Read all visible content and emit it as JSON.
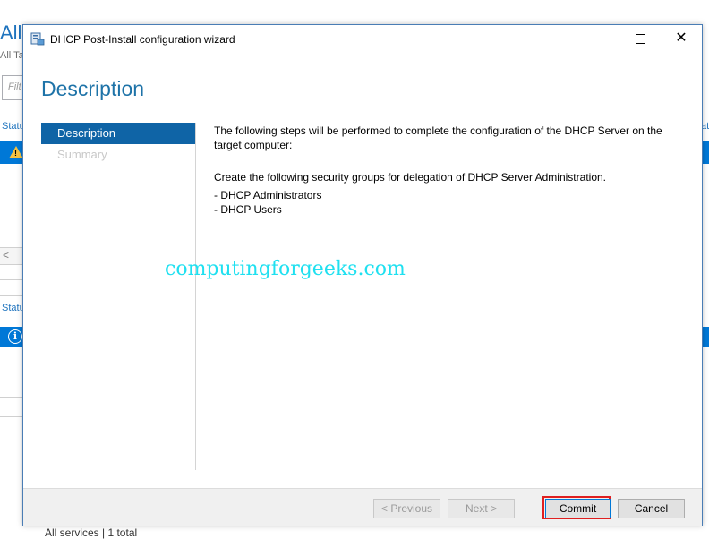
{
  "background": {
    "title": "All",
    "subtitle": "All Tas",
    "filter_placeholder": "Filt",
    "status_header_1": "Statu",
    "status_header_2": "Statu",
    "right_header": "at",
    "scroll_left": "<",
    "footer_text": "All services | 1 total"
  },
  "window": {
    "title": "DHCP Post-Install configuration wizard",
    "controls": {
      "minimize": "",
      "maximize": "",
      "close": "✕"
    },
    "heading": "Description",
    "nav": [
      {
        "label": "Description",
        "state": "active"
      },
      {
        "label": "Summary",
        "state": "disabled"
      }
    ],
    "content": {
      "intro": "The following steps will be performed to complete the configuration of the DHCP Server on the target computer:",
      "groups_intro": "Create the following security groups for delegation of DHCP Server Administration.",
      "groups": [
        "- DHCP Administrators",
        "- DHCP Users"
      ]
    },
    "watermark": "computingforgeeks.com",
    "buttons": {
      "previous": "< Previous",
      "next": "Next >",
      "commit": "Commit",
      "cancel": "Cancel"
    }
  },
  "colors": {
    "accent": "#0f64a6",
    "heading": "#1e73a8",
    "highlight_border": "#e02020",
    "watermark": "#1fe0f0"
  }
}
